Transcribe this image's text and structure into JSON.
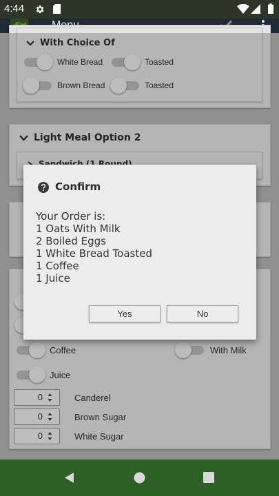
{
  "status_bar": {
    "time": "4:44",
    "icons": [
      "gear-icon",
      "sd-card-icon",
      "wifi-icon",
      "signal-icon",
      "battery-icon"
    ]
  },
  "app_bar": {
    "title": "Menu",
    "icons": [
      "app-logo",
      "check-icon",
      "more-vert-icon"
    ]
  },
  "sections": {
    "choice": {
      "title": "With Choice Of",
      "rows": [
        {
          "bread": "White Bread",
          "bread_on": true,
          "toast": "Toasted",
          "toast_on": true
        },
        {
          "bread": "Brown Bread",
          "bread_on": false,
          "toast": "Toasted",
          "toast_on": false
        }
      ]
    },
    "light_meal_2": {
      "title": "Light Meal Option 2",
      "sub_title": "Sandwich (1 Round)"
    },
    "drinks": {
      "coffee": "Coffee",
      "coffee_on": true,
      "with_milk": "With Milk",
      "with_milk_on": false,
      "juice": "Juice",
      "juice_on": true,
      "steppers": [
        {
          "value": "0",
          "label": "Canderel"
        },
        {
          "value": "0",
          "label": "Brown Sugar"
        },
        {
          "value": "0",
          "label": "White Sugar"
        }
      ]
    }
  },
  "dialog": {
    "title": "Confirm",
    "icon": "help-circle-icon",
    "heading": "Your Order is:",
    "lines": [
      "1 Oats With Milk",
      "2 Boiled Eggs",
      "1 White Bread Toasted",
      "1 Coffee",
      "1 Juice"
    ],
    "yes_label": "Yes",
    "no_label": "No"
  },
  "nav_bar": {
    "icons": [
      "back-icon",
      "home-icon",
      "recents-icon"
    ]
  },
  "colors": {
    "status_bar": "#2c3527",
    "app_bar": "#1e2a38",
    "nav_bar": "#2b5f24",
    "card": "#e3e3e3",
    "dialog": "#ececec"
  }
}
